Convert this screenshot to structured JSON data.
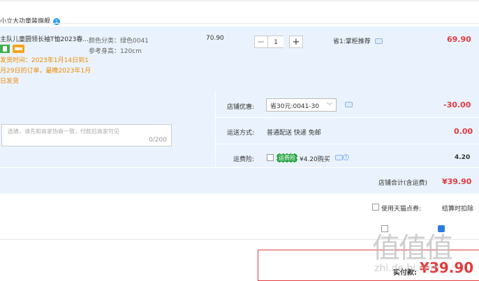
{
  "shop": {
    "name": "小立大功童装旗舰",
    "badge": "1"
  },
  "item": {
    "title": "主队儿童圆领长袖T恤2023春...",
    "presale": [
      "发货时间：2023年1月14日到1",
      "月29日的订单，最晚2023年1月",
      "日发货"
    ],
    "sku_color": "颜色分类：绿色0041",
    "sku_height": "参考身高：120cm",
    "unit_price": "70.90",
    "qty_minus": "−",
    "qty_value": "1",
    "qty_plus": "+",
    "discount": "省1:掌柜推荐",
    "subtotal": "69.90"
  },
  "summary": {
    "note_placeholder": "选填，请先和商家协商一致，付款后商家可见",
    "note_count": "0/200",
    "coupon_label": "店铺优惠:",
    "coupon_value": "省30元:0041-30",
    "coupon_amount": "-30.00",
    "shipping_label": "运送方式:",
    "shipping_value": "普通配送 快递 免邮",
    "shipping_amount": "0.00",
    "insurance_label": "运费险:",
    "insurance_tag": "运费险",
    "insurance_price": "¥4.20购买",
    "insurance_amount": "4.20",
    "shop_total_label": "店铺合计(含运费)",
    "shop_total": "¥39.90"
  },
  "tmall": {
    "label": "使用天猫点券:",
    "right": "结算时扣除"
  },
  "pay": {
    "label": "实付款:",
    "amount": "¥39.90"
  },
  "watermark": {
    "glyphs": "值值值",
    "site": "zhi.de.hi.com"
  }
}
